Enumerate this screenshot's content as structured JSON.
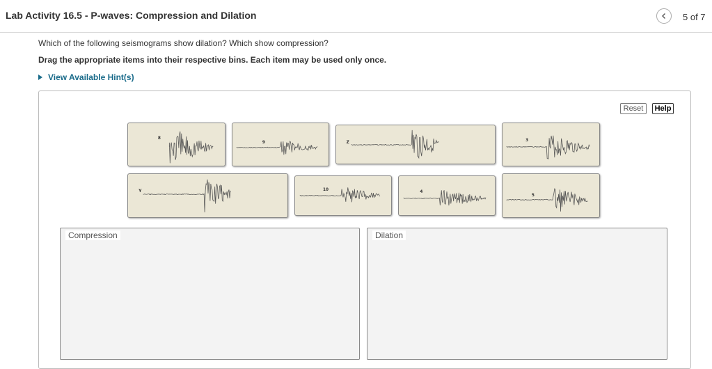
{
  "header": {
    "title": "Lab Activity 16.5 - P-waves: Compression and Dilation",
    "page_count": "5 of 7",
    "back_icon": "chevron-left-icon"
  },
  "prompt": {
    "question": "Which of the following seismograms show dilation? Which show compression?",
    "instruction": "Drag the appropriate items into their respective bins. Each item may be used only once.",
    "hint_link": "View Available Hint(s)"
  },
  "toolbar": {
    "reset_label": "Reset",
    "help_label": "Help"
  },
  "seismograms": [
    {
      "id": "8",
      "label": "8"
    },
    {
      "id": "9",
      "label": "9"
    },
    {
      "id": "Z",
      "label": "Z"
    },
    {
      "id": "3",
      "label": "3"
    },
    {
      "id": "Y",
      "label": "Y"
    },
    {
      "id": "10",
      "label": "10"
    },
    {
      "id": "4",
      "label": "4"
    },
    {
      "id": "5",
      "label": "5"
    }
  ],
  "bins": {
    "compression_label": "Compression",
    "dilation_label": "Dilation"
  },
  "colors": {
    "link": "#1a6b8a",
    "tile_bg": "#ebe7d6",
    "bin_bg": "#f3f3f3"
  }
}
